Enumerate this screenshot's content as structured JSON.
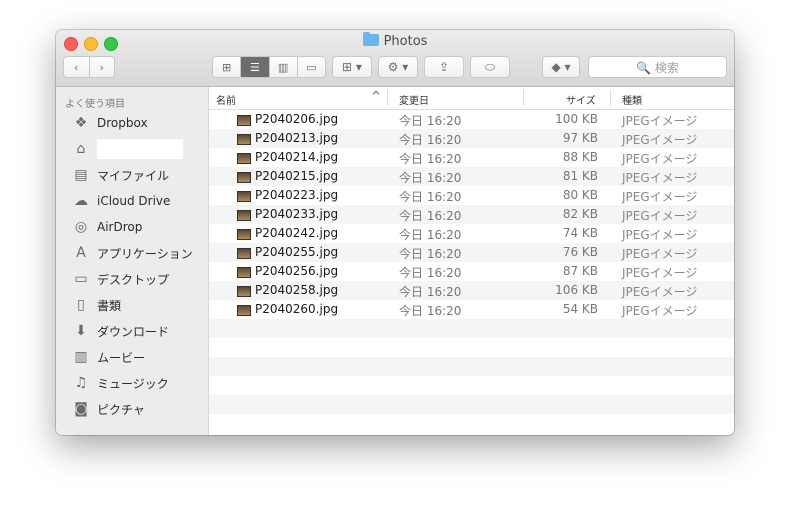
{
  "window": {
    "title": "Photos"
  },
  "toolbar": {
    "back": "‹",
    "forward": "›",
    "arrange": "⊞ ▾",
    "action": "⚙ ▾",
    "share": "⇪",
    "tag": "⬭",
    "dropbox": "◆ ▾",
    "view_icon": "⊞",
    "view_list": "☰",
    "view_columns": "▥",
    "view_cover": "▭",
    "search_placeholder": "🔍 検索"
  },
  "sidebar": {
    "header": "よく使う項目",
    "items": [
      {
        "label": "Dropbox",
        "icon": "❖"
      },
      {
        "label": "",
        "icon": "⌂"
      },
      {
        "label": "マイファイル",
        "icon": "▤"
      },
      {
        "label": "iCloud Drive",
        "icon": "☁"
      },
      {
        "label": "AirDrop",
        "icon": "◎"
      },
      {
        "label": "アプリケーション",
        "icon": "A"
      },
      {
        "label": "デスクトップ",
        "icon": "▭"
      },
      {
        "label": "書類",
        "icon": "▯"
      },
      {
        "label": "ダウンロード",
        "icon": "⬇"
      },
      {
        "label": "ムービー",
        "icon": "▥"
      },
      {
        "label": "ミュージック",
        "icon": "♫"
      },
      {
        "label": "ピクチャ",
        "icon": "◙"
      }
    ]
  },
  "columns": {
    "name": "名前",
    "date": "変更日",
    "size": "サイズ",
    "kind": "種類",
    "sort_indicator": "^"
  },
  "files": [
    {
      "name": "P2040206.jpg",
      "date": "今日 16:20",
      "size": "100 KB",
      "kind": "JPEGイメージ"
    },
    {
      "name": "P2040213.jpg",
      "date": "今日 16:20",
      "size": "97 KB",
      "kind": "JPEGイメージ"
    },
    {
      "name": "P2040214.jpg",
      "date": "今日 16:20",
      "size": "88 KB",
      "kind": "JPEGイメージ"
    },
    {
      "name": "P2040215.jpg",
      "date": "今日 16:20",
      "size": "81 KB",
      "kind": "JPEGイメージ"
    },
    {
      "name": "P2040223.jpg",
      "date": "今日 16:20",
      "size": "80 KB",
      "kind": "JPEGイメージ"
    },
    {
      "name": "P2040233.jpg",
      "date": "今日 16:20",
      "size": "82 KB",
      "kind": "JPEGイメージ"
    },
    {
      "name": "P2040242.jpg",
      "date": "今日 16:20",
      "size": "74 KB",
      "kind": "JPEGイメージ"
    },
    {
      "name": "P2040255.jpg",
      "date": "今日 16:20",
      "size": "76 KB",
      "kind": "JPEGイメージ"
    },
    {
      "name": "P2040256.jpg",
      "date": "今日 16:20",
      "size": "87 KB",
      "kind": "JPEGイメージ"
    },
    {
      "name": "P2040258.jpg",
      "date": "今日 16:20",
      "size": "106 KB",
      "kind": "JPEGイメージ"
    },
    {
      "name": "P2040260.jpg",
      "date": "今日 16:20",
      "size": "54 KB",
      "kind": "JPEGイメージ"
    }
  ]
}
